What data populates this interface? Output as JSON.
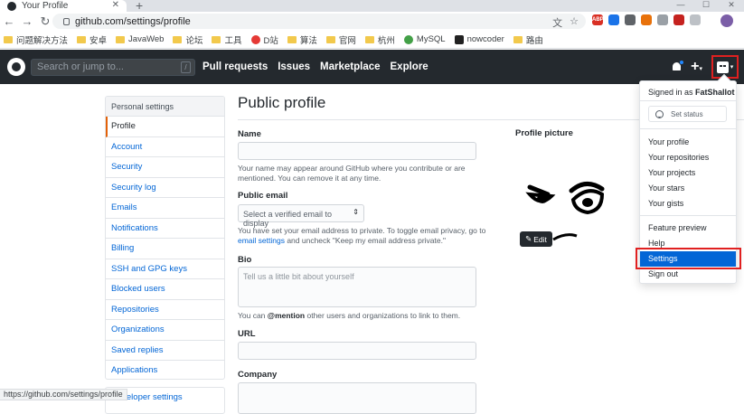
{
  "browser": {
    "tab_title": "Your Profile",
    "new_tab": "+",
    "url": "github.com/settings/profile",
    "status_url": "https://github.com/settings/profile",
    "ext_label_abp": "ABP",
    "bookmarks": [
      "问题解决方法",
      "安卓",
      "JavaWeb",
      "论坛",
      "工具",
      "D站",
      "算法",
      "官网",
      "杭州",
      "MySQL",
      "nowcoder",
      "路由"
    ]
  },
  "header": {
    "search_placeholder": "Search or jump to...",
    "search_shortcut": "/",
    "nav": [
      "Pull requests",
      "Issues",
      "Marketplace",
      "Explore"
    ],
    "plus": "+",
    "caret": "▾"
  },
  "sidebar": {
    "heading": "Personal settings",
    "items": [
      "Profile",
      "Account",
      "Security",
      "Security log",
      "Emails",
      "Notifications",
      "Billing",
      "SSH and GPG keys",
      "Blocked users",
      "Repositories",
      "Organizations",
      "Saved replies",
      "Applications"
    ],
    "second_item": "Developer settings"
  },
  "main": {
    "title": "Public profile",
    "name_label": "Name",
    "name_note": "Your name may appear around GitHub where you contribute or are mentioned. You can remove it at any time.",
    "email_label": "Public email",
    "email_select": "Select a verified email to display",
    "email_note_pre": "You have set your email address to private. To toggle email privacy, go to ",
    "email_note_link": "email settings",
    "email_note_post": " and uncheck \"Keep my email address private.\"",
    "bio_label": "Bio",
    "bio_placeholder": "Tell us a little bit about yourself",
    "bio_note_pre": "You can ",
    "bio_note_mention": "@mention",
    "bio_note_post": " other users and organizations to link to them.",
    "url_label": "URL",
    "company_label": "Company",
    "picture_label": "Profile picture",
    "edit_label": "Edit"
  },
  "dropdown": {
    "signed_in_prefix": "Signed in as ",
    "username": "FatShallot",
    "set_status": "Set status",
    "items_a": [
      "Your profile",
      "Your repositories",
      "Your projects",
      "Your stars",
      "Your gists"
    ],
    "items_b": [
      "Feature preview",
      "Help",
      "Settings",
      "Sign out"
    ]
  },
  "colors": {
    "header_bg": "#24292e",
    "link": "#0366d6",
    "highlight": "#0366d6",
    "annotation_red": "#e02020",
    "active_accent": "#e36209"
  }
}
